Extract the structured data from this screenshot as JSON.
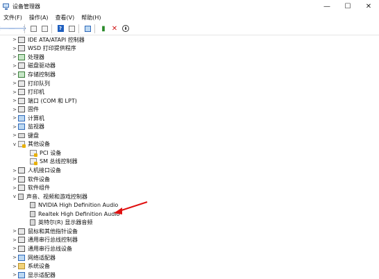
{
  "window": {
    "title": "设备管理器",
    "controls": {
      "minimize": "—",
      "maximize": "☐",
      "close": "✕"
    }
  },
  "menu": [
    "文件(F)",
    "操作(A)",
    "查看(V)",
    "帮助(H)"
  ],
  "toolbar": {
    "back": "🡐",
    "forward": "🡒",
    "help": "?",
    "uninstall": "✕",
    "update": "⬇"
  },
  "tree": {
    "rows": [
      {
        "label": "IDE ATA/ATAPI 控制器",
        "chevron": ">",
        "indent": 0,
        "icon": "dev"
      },
      {
        "label": "WSD 打印提供程序",
        "chevron": ">",
        "indent": 0,
        "icon": "dev"
      },
      {
        "label": "处理器",
        "chevron": ">",
        "indent": 0,
        "icon": "green"
      },
      {
        "label": "磁盘驱动器",
        "chevron": ">",
        "indent": 0,
        "icon": "dev"
      },
      {
        "label": "存储控制器",
        "chevron": ">",
        "indent": 0,
        "icon": "green"
      },
      {
        "label": "打印队列",
        "chevron": ">",
        "indent": 0,
        "icon": "dev"
      },
      {
        "label": "打印机",
        "chevron": ">",
        "indent": 0,
        "icon": "dev"
      },
      {
        "label": "端口 (COM 和 LPT)",
        "chevron": ">",
        "indent": 0,
        "icon": "dev"
      },
      {
        "label": "固件",
        "chevron": ">",
        "indent": 0,
        "icon": "dev"
      },
      {
        "label": "计算机",
        "chevron": ">",
        "indent": 0,
        "icon": "mon"
      },
      {
        "label": "监视器",
        "chevron": ">",
        "indent": 0,
        "icon": "mon"
      },
      {
        "label": "键盘",
        "chevron": ">",
        "indent": 0,
        "icon": "kbd"
      },
      {
        "label": "其他设备",
        "chevron": "v",
        "indent": 0,
        "icon": "warn"
      },
      {
        "label": "PCI 设备",
        "chevron": "",
        "indent": 1,
        "icon": "warn"
      },
      {
        "label": "SM 总线控制器",
        "chevron": "",
        "indent": 1,
        "icon": "warn"
      },
      {
        "label": "人机接口设备",
        "chevron": ">",
        "indent": 0,
        "icon": "dev"
      },
      {
        "label": "软件设备",
        "chevron": ">",
        "indent": 0,
        "icon": "dev"
      },
      {
        "label": "软件组件",
        "chevron": ">",
        "indent": 0,
        "icon": "dev"
      },
      {
        "label": "声音、视频和游戏控制器",
        "chevron": "v",
        "indent": 0,
        "icon": "speaker"
      },
      {
        "label": "NVIDIA High Definition Audio",
        "chevron": "",
        "indent": 1,
        "icon": "speaker"
      },
      {
        "label": "Realtek High Definition Audio",
        "chevron": "",
        "indent": 1,
        "icon": "speaker"
      },
      {
        "label": "英特尔(R) 显示器音频",
        "chevron": "",
        "indent": 1,
        "icon": "speaker"
      },
      {
        "label": "鼠标和其他指针设备",
        "chevron": ">",
        "indent": 0,
        "icon": "dev"
      },
      {
        "label": "通用串行总线控制器",
        "chevron": ">",
        "indent": 0,
        "icon": "dev"
      },
      {
        "label": "通用串行总线设备",
        "chevron": ">",
        "indent": 0,
        "icon": "dev"
      },
      {
        "label": "网络适配器",
        "chevron": ">",
        "indent": 0,
        "icon": "mon"
      },
      {
        "label": "系统设备",
        "chevron": ">",
        "indent": 0,
        "icon": "folder"
      },
      {
        "label": "显示适配器",
        "chevron": ">",
        "indent": 0,
        "icon": "mon"
      }
    ]
  },
  "annotation": {
    "arrow_color": "#e01010"
  }
}
